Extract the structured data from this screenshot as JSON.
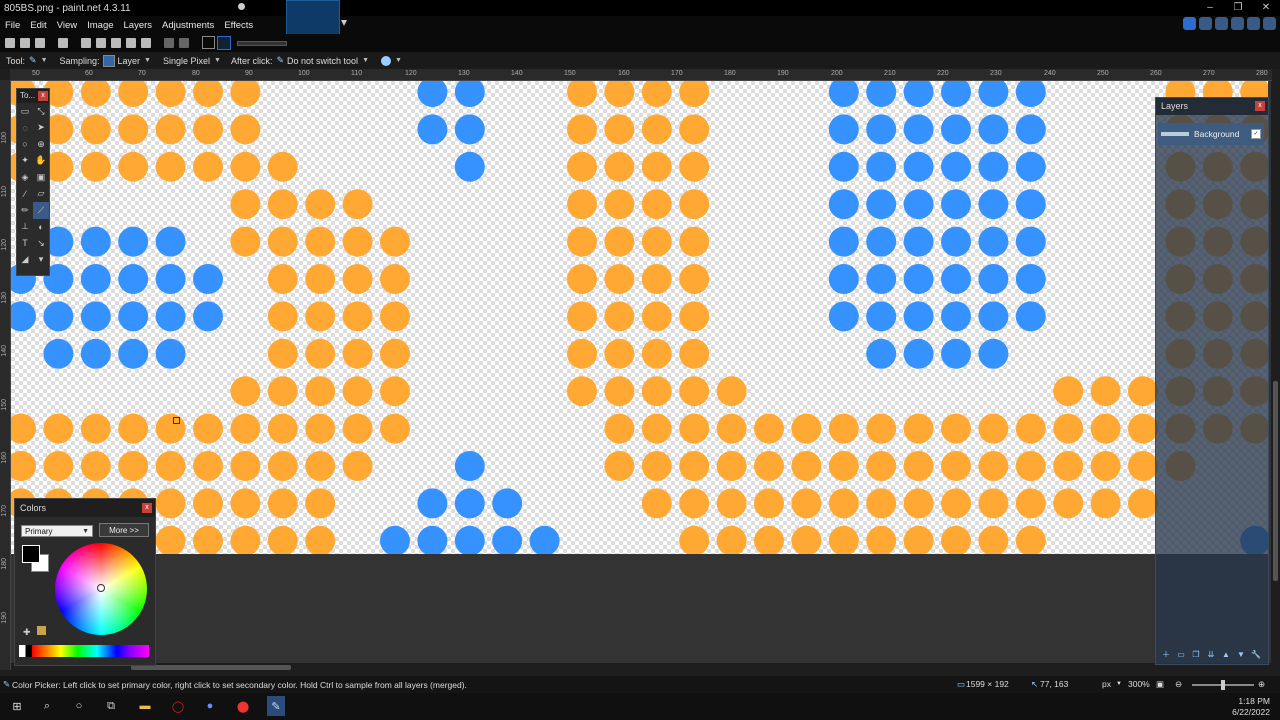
{
  "app": {
    "title": "805BS.png - paint.net 4.3.11",
    "window_controls": [
      "–",
      "❐",
      "✕"
    ]
  },
  "menu": [
    "File",
    "Edit",
    "View",
    "Image",
    "Layers",
    "Adjustments",
    "Effects"
  ],
  "toolbar": {
    "tool_label": "Tool:",
    "sampling_label": "Sampling:",
    "sampling_value": "Layer",
    "sampling_mode": "Single Pixel",
    "after_click_label": "After click:",
    "after_click_value": "Do not switch tool"
  },
  "ruler": {
    "h_ticks": [
      "50",
      "60",
      "70",
      "80",
      "90",
      "100",
      "110",
      "120",
      "130",
      "140",
      "150",
      "160",
      "170",
      "180",
      "190",
      "200",
      "210",
      "220",
      "230",
      "240",
      "250",
      "260",
      "270",
      "280"
    ],
    "v_ticks": [
      "100",
      "110",
      "120",
      "130",
      "140",
      "150",
      "160",
      "170",
      "180",
      "190",
      "200"
    ]
  },
  "tools_panel": {
    "title": "To...",
    "close": "x"
  },
  "layers_panel": {
    "title": "Layers",
    "close": "x",
    "layer_name": "Background",
    "layer_visible": "✓"
  },
  "colors_panel": {
    "title": "Colors",
    "close": "x",
    "mode": "Primary",
    "more_label": "More >>",
    "primary_color": "#000000",
    "secondary_color": "#ffffff"
  },
  "statusbar": {
    "message": "Color Picker: Left click to set primary color, right click to set secondary color. Hold Ctrl to sample from all layers (merged).",
    "image_size": "1599 × 192",
    "cursor_pos": "77, 163",
    "units": "px",
    "zoom": "300%"
  },
  "taskbar": {
    "time": "1:18 PM",
    "date": "6/22/2022"
  },
  "colors": {
    "orange_dot": "#ffa934",
    "blue_dot": "#3592ff",
    "accent": "#2d6bd0"
  }
}
